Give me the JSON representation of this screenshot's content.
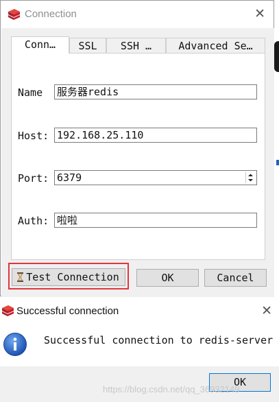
{
  "window": {
    "title": "Connection",
    "tabs": [
      {
        "label": "Conn…"
      },
      {
        "label": "SSL"
      },
      {
        "label": "SSH …"
      },
      {
        "label": "Advanced Se…"
      }
    ],
    "fields": {
      "name": {
        "label": "Name",
        "value": "服务器redis"
      },
      "host": {
        "label": "Host:",
        "value": "192.168.25.110"
      },
      "port": {
        "label": "Port:",
        "value": "6379"
      },
      "auth": {
        "label": "Auth:",
        "value": "啦啦"
      }
    },
    "buttons": {
      "test": "Test Connection",
      "ok": "OK",
      "cancel": "Cancel"
    }
  },
  "dialog": {
    "title": "Successful connection",
    "message": "Successful connection to redis-server",
    "ok": "OK"
  },
  "watermark": "https://blog.csdn.net/qq_36932149",
  "colors": {
    "highlight": "#e0353b",
    "info": "#1e63c4",
    "logo": "#c8202a"
  }
}
